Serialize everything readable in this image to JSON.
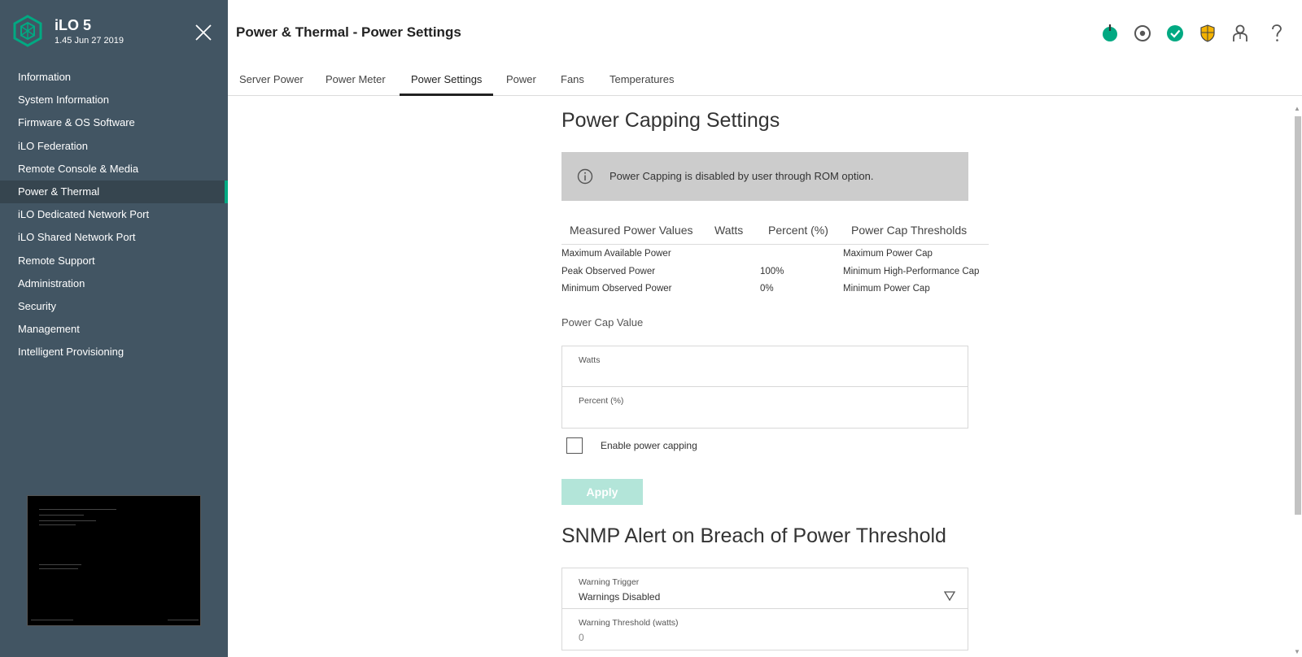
{
  "app": {
    "name": "iLO 5",
    "version": "1.45 Jun 27 2019"
  },
  "sidebar": {
    "items": [
      {
        "label": "Information"
      },
      {
        "label": "System Information"
      },
      {
        "label": "Firmware & OS Software"
      },
      {
        "label": "iLO Federation"
      },
      {
        "label": "Remote Console & Media"
      },
      {
        "label": "Power & Thermal",
        "active": true
      },
      {
        "label": "iLO Dedicated Network Port"
      },
      {
        "label": "iLO Shared Network Port"
      },
      {
        "label": "Remote Support"
      },
      {
        "label": "Administration"
      },
      {
        "label": "Security"
      },
      {
        "label": "Management"
      },
      {
        "label": "Intelligent Provisioning"
      }
    ]
  },
  "header": {
    "title": "Power & Thermal - Power Settings",
    "icons": [
      "power-status-icon",
      "locator-icon",
      "health-ok-icon",
      "security-shield-icon",
      "user-icon",
      "help-icon"
    ],
    "colors": {
      "power": "#01a982",
      "health": "#01a982",
      "shield": "#f5b300",
      "icon": "#555555"
    }
  },
  "tabs": [
    {
      "label": "Server Power"
    },
    {
      "label": "Power Meter"
    },
    {
      "label": "Power Settings",
      "active": true
    },
    {
      "label": "Power"
    },
    {
      "label": "Fans"
    },
    {
      "label": "Temperatures"
    }
  ],
  "power_capping": {
    "title": "Power Capping Settings",
    "info_message": "Power Capping is disabled by user through ROM option.",
    "table": {
      "headers": [
        "Measured Power Values",
        "Watts",
        "Percent (%)",
        "Power Cap Thresholds"
      ],
      "rows": [
        {
          "measured": "Maximum Available Power",
          "watts": "",
          "percent": "",
          "threshold": "Maximum Power Cap"
        },
        {
          "measured": "Peak Observed Power",
          "watts": "",
          "percent": "100%",
          "threshold": "Minimum High-Performance Cap"
        },
        {
          "measured": "Minimum Observed Power",
          "watts": "",
          "percent": "0%",
          "threshold": "Minimum Power Cap"
        }
      ]
    },
    "cap_value_label": "Power Cap Value",
    "watts_label": "Watts",
    "watts_value": "",
    "percent_label": "Percent (%)",
    "percent_value": "",
    "enable_label": "Enable power capping",
    "enable_checked": false,
    "apply_label": "Apply"
  },
  "snmp": {
    "title": "SNMP Alert on Breach of Power Threshold",
    "trigger_label": "Warning Trigger",
    "trigger_value": "Warnings Disabled",
    "threshold_label": "Warning Threshold (watts)",
    "threshold_placeholder": "0"
  }
}
